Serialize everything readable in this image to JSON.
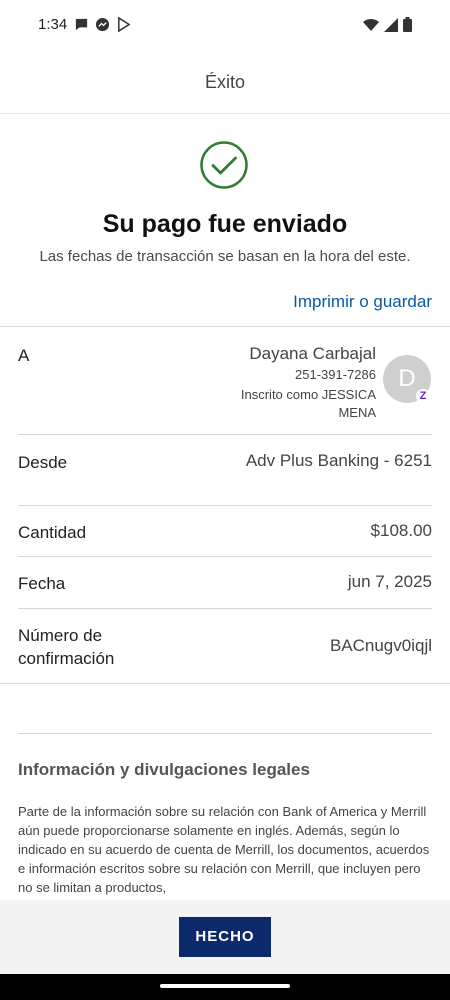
{
  "status_bar": {
    "time": "1:34",
    "left_icons": [
      "message-icon",
      "messenger-icon",
      "play-store-icon"
    ],
    "right_icons": [
      "wifi-icon",
      "signal-icon",
      "battery-icon"
    ]
  },
  "header": {
    "title": "Éxito"
  },
  "confirmation": {
    "title": "Su pago fue enviado",
    "subtitle": "Las fechas de transacción se basan en la hora del este.",
    "print_link": "Imprimir o guardar",
    "accent_color": "#2e7d32",
    "link_color": "#0a5aa0"
  },
  "details": {
    "to_label": "A",
    "recipient_name": "Dayana Carbajal",
    "recipient_phone": "251-391-7286",
    "recipient_enrolled": "Inscrito como JESSICA MENA",
    "avatar_initial": "D",
    "zelle_badge": "Z",
    "from_label": "Desde",
    "from_value": "Adv Plus Banking - 6251",
    "amount_label": "Cantidad",
    "amount_value": "$108.00",
    "date_label": "Fecha",
    "date_value": "jun 7, 2025",
    "confirmation_label": "Número de confirmación",
    "confirmation_value": "BACnugv0iqjl"
  },
  "legal": {
    "title": "Información y divulgaciones legales",
    "body": "Parte de la información sobre su relación con Bank of America y Merrill aún puede proporcionarse solamente en inglés. Además, según lo indicado en su acuerdo de cuenta de Merrill, los documentos, acuerdos e información escritos sobre su relación con Merrill, que incluyen pero no se limitan a productos,"
  },
  "footer": {
    "done_label": "HECHO",
    "button_color": "#0c2a6b"
  }
}
